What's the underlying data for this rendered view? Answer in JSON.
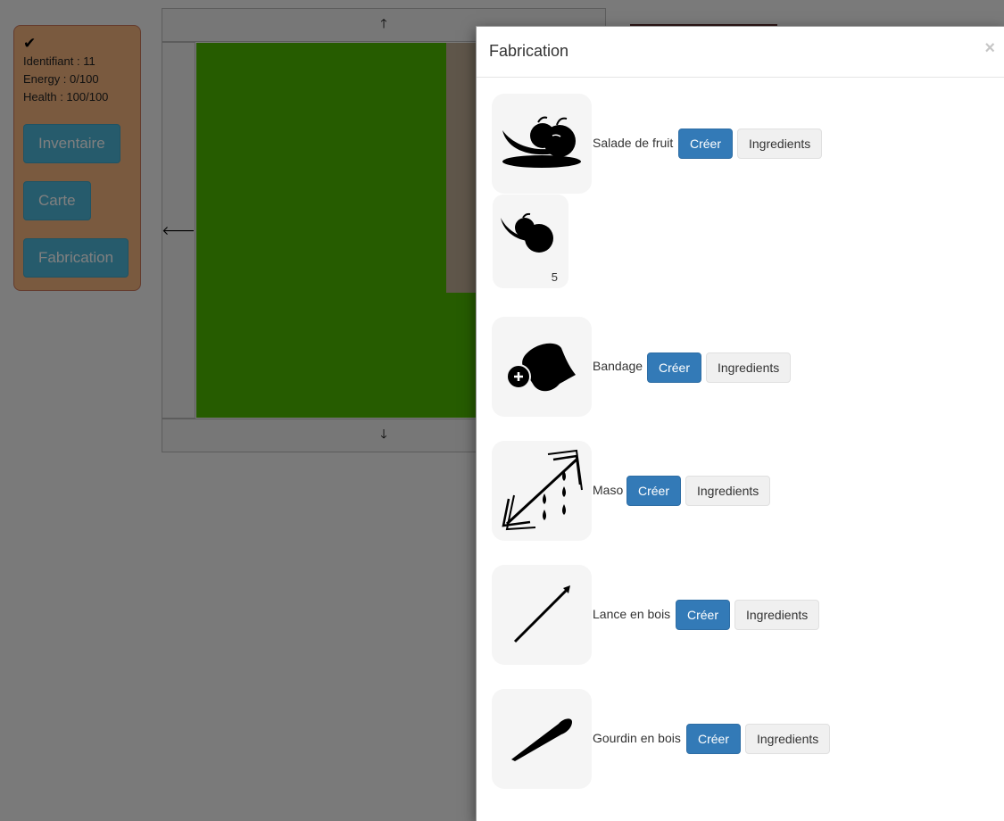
{
  "status": {
    "check_icon": "checkmark-icon",
    "identifiant": "Identifiant : 11",
    "energy": "Energy : 0/100",
    "health": "Health : 100/100",
    "buttons": {
      "inventory": "Inventaire",
      "map": "Carte",
      "crafting": "Fabrication"
    }
  },
  "map": {
    "arrows": {
      "up": "arrow-up-icon",
      "down": "arrow-down-icon",
      "left": "arrow-left-icon"
    }
  },
  "modal": {
    "title": "Fabrication",
    "close": "×",
    "recipes": [
      {
        "name": "Salade de fruit",
        "create": "Créer",
        "ingredients": "Ingredients",
        "icon": "fruit-salad-icon"
      },
      {
        "name": "Bandage",
        "create": "Créer",
        "ingredients": "Ingredients",
        "icon": "bandage-icon"
      },
      {
        "name": "Maso",
        "create": "Créer",
        "ingredients": "Ingredients",
        "icon": "maso-icon"
      },
      {
        "name": "Lance en bois",
        "create": "Créer",
        "ingredients": "Ingredients",
        "icon": "wooden-spear-icon"
      },
      {
        "name": "Gourdin en bois",
        "create": "Créer",
        "ingredients": "Ingredients",
        "icon": "wooden-club-icon"
      }
    ],
    "sub_ingredient": {
      "icon": "fruit-icon",
      "count": "5"
    }
  },
  "colors": {
    "primary": "#337ab7",
    "info": "#4cb6d8",
    "grass": "#4cb900",
    "panel": "#f4b57f"
  }
}
